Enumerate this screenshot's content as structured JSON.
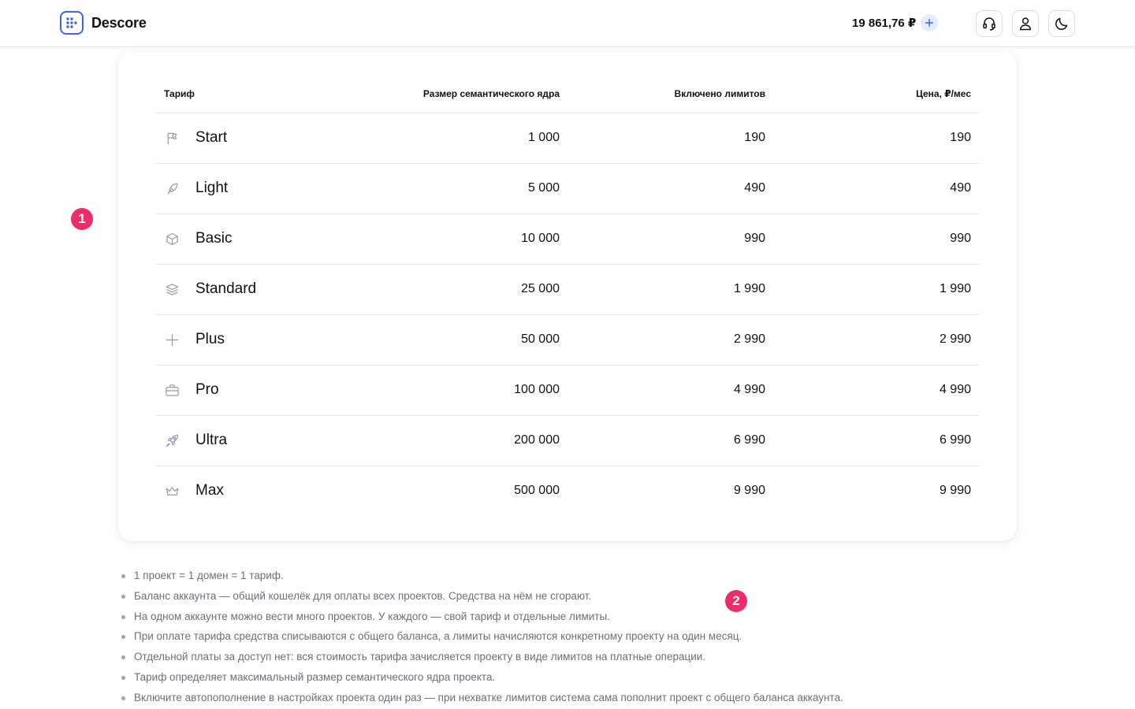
{
  "header": {
    "brand": "Descore",
    "balance": "19 861,76 ₽",
    "buttons": {
      "add_funds_icon": "plus-icon",
      "support_icon": "headset-icon",
      "profile_icon": "user-icon",
      "theme_icon": "moon-icon"
    },
    "accent_color": "#3f63e6"
  },
  "table": {
    "columns": [
      "Тариф",
      "Размер семантического ядра",
      "Включено лимитов",
      "Цена, ₽/мес"
    ],
    "rows": [
      {
        "icon": "flag-icon",
        "name": "Start",
        "core_size": "1 000",
        "limits": "190",
        "price": "190"
      },
      {
        "icon": "feather-icon",
        "name": "Light",
        "core_size": "5 000",
        "limits": "490",
        "price": "490"
      },
      {
        "icon": "cube-icon",
        "name": "Basic",
        "core_size": "10 000",
        "limits": "990",
        "price": "990"
      },
      {
        "icon": "layers-icon",
        "name": "Standard",
        "core_size": "25 000",
        "limits": "1 990",
        "price": "1 990"
      },
      {
        "icon": "plus-icon",
        "name": "Plus",
        "core_size": "50 000",
        "limits": "2 990",
        "price": "2 990"
      },
      {
        "icon": "briefcase-icon",
        "name": "Pro",
        "core_size": "100 000",
        "limits": "4 990",
        "price": "4 990"
      },
      {
        "icon": "rocket-icon",
        "name": "Ultra",
        "core_size": "200 000",
        "limits": "6 990",
        "price": "6 990"
      },
      {
        "icon": "crown-icon",
        "name": "Max",
        "core_size": "500 000",
        "limits": "9 990",
        "price": "9 990"
      }
    ]
  },
  "markers": [
    "1",
    "2"
  ],
  "marker_color": "#ee2c69",
  "notes": [
    "1 проект = 1 домен = 1 тариф.",
    "Баланс аккаунта — общий кошелёк для оплаты всех проектов. Средства на нём не сгорают.",
    "На одном аккаунте можно вести много проектов. У каждого — свой тариф и отдельные лимиты.",
    "При оплате тарифа средства списываются с общего баланса, а лимиты начисляются конкретному проекту на один месяц.",
    "Отдельной платы за доступ нет: вся стоимость тарифа зачисляется проекту в виде лимитов на платные операции.",
    "Тариф определяет максимальный размер семантического ядра проекта.",
    "Включите автопополнение в настройках проекта один раз — при нехватке лимитов система сама пополнит проект с общего баланса аккаунта."
  ]
}
